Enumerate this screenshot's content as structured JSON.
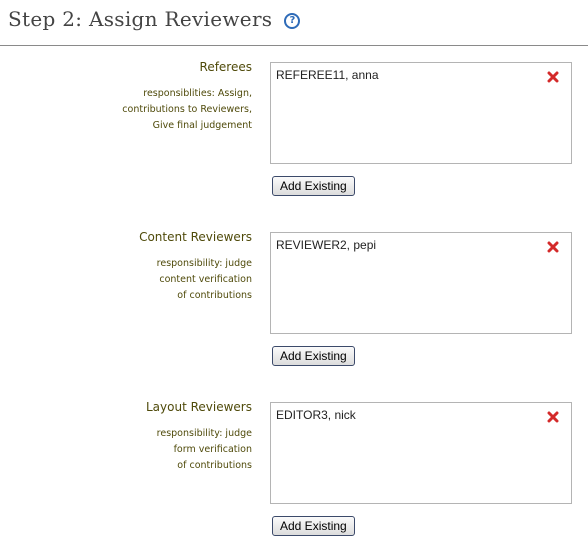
{
  "header": {
    "title": "Step 2: Assign Reviewers",
    "help_icon": "question-circle-icon",
    "help_glyph": "?"
  },
  "sections": [
    {
      "title": "Referees",
      "description": [
        "responsiblities: Assign,",
        "contributions to Reviewers,",
        "Give final judgement"
      ],
      "members": [
        "REFEREE11, anna"
      ],
      "add_label": "Add Existing"
    },
    {
      "title": "Content Reviewers",
      "description": [
        "responsibility: judge",
        "content verification",
        "of contributions"
      ],
      "members": [
        "REVIEWER2, pepi"
      ],
      "add_label": "Add Existing"
    },
    {
      "title": "Layout Reviewers",
      "description": [
        "responsibility: judge",
        "form verification",
        "of contributions"
      ],
      "members": [
        "EDITOR3, nick"
      ],
      "add_label": "Add Existing"
    }
  ],
  "colors": {
    "label_text": "#4f4a0a",
    "remove_icon": "#d42a2a",
    "help_icon": "#2e6bb8",
    "box_border": "#b4b4b4"
  }
}
